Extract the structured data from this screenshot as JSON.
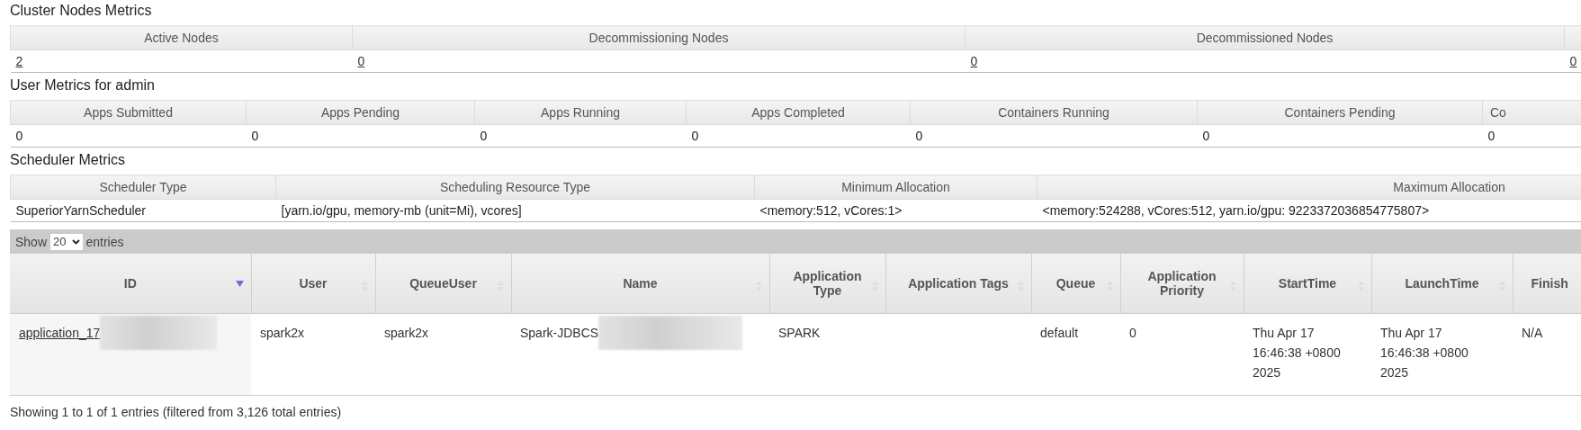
{
  "metric_sections": [
    {
      "title": "Cluster Nodes Metrics",
      "linked": true,
      "columns": [
        {
          "label": "Active Nodes",
          "value": "2"
        },
        {
          "label": "Decommissioning Nodes",
          "value": "0"
        },
        {
          "label": "Decommissioned Nodes",
          "value": "0"
        },
        {
          "value": "0"
        }
      ]
    },
    {
      "title": "User Metrics for admin",
      "linked": false,
      "columns": [
        {
          "label": "Apps Submitted",
          "value": "0"
        },
        {
          "label": "Apps Pending",
          "value": "0"
        },
        {
          "label": "Apps Running",
          "value": "0"
        },
        {
          "label": "Apps Completed",
          "value": "0"
        },
        {
          "label": "Containers Running",
          "value": "0"
        },
        {
          "label": "Containers Pending",
          "value": "0"
        },
        {
          "label": "Co",
          "value": "0"
        }
      ]
    },
    {
      "title": "Scheduler Metrics",
      "linked": false,
      "columns": [
        {
          "label": "Scheduler Type",
          "value": "SuperiorYarnScheduler"
        },
        {
          "label": "Scheduling Resource Type",
          "value": "[yarn.io/gpu, memory-mb (unit=Mi), vcores]"
        },
        {
          "label": "Minimum Allocation",
          "value": "<memory:512, vCores:1>"
        },
        {
          "label": "Maximum Allocation",
          "value": "<memory:524288, vCores:512, yarn.io/gpu: 9223372036854775807>"
        }
      ]
    }
  ],
  "apps_table": {
    "length_menu": {
      "before": "Show",
      "value": "20",
      "after": "entries"
    },
    "columns": [
      {
        "label": "ID",
        "sorted": true
      },
      {
        "label": "User",
        "sorted": false
      },
      {
        "label": "QueueUser",
        "sorted": false
      },
      {
        "label": "Name",
        "sorted": false
      },
      {
        "label": "Application Type",
        "sorted": false
      },
      {
        "label": "Application Tags",
        "sorted": false
      },
      {
        "label": "Queue",
        "sorted": false
      },
      {
        "label": "Application Priority",
        "sorted": false
      },
      {
        "label": "StartTime",
        "sorted": false
      },
      {
        "label": "LaunchTime",
        "sorted": false
      },
      {
        "label": "Finish"
      }
    ],
    "rows": [
      {
        "cells": [
          {
            "text": "application_17",
            "link": true,
            "redacted": true
          },
          {
            "text": "spark2x"
          },
          {
            "text": "spark2x"
          },
          {
            "text": "Spark-JDBCS",
            "redacted": true
          },
          {
            "text": "SPARK"
          },
          {},
          {
            "text": "default"
          },
          {
            "text": "0"
          },
          {
            "text": "Thu Apr 17 16:46:38 +0800 2025"
          },
          {
            "text": "Thu Apr 17 16:46:38 +0800 2025"
          },
          {
            "text": "N/A"
          }
        ]
      }
    ],
    "info": "Showing 1 to 1 of 1 entries (filtered from 3,126 total entries)"
  }
}
